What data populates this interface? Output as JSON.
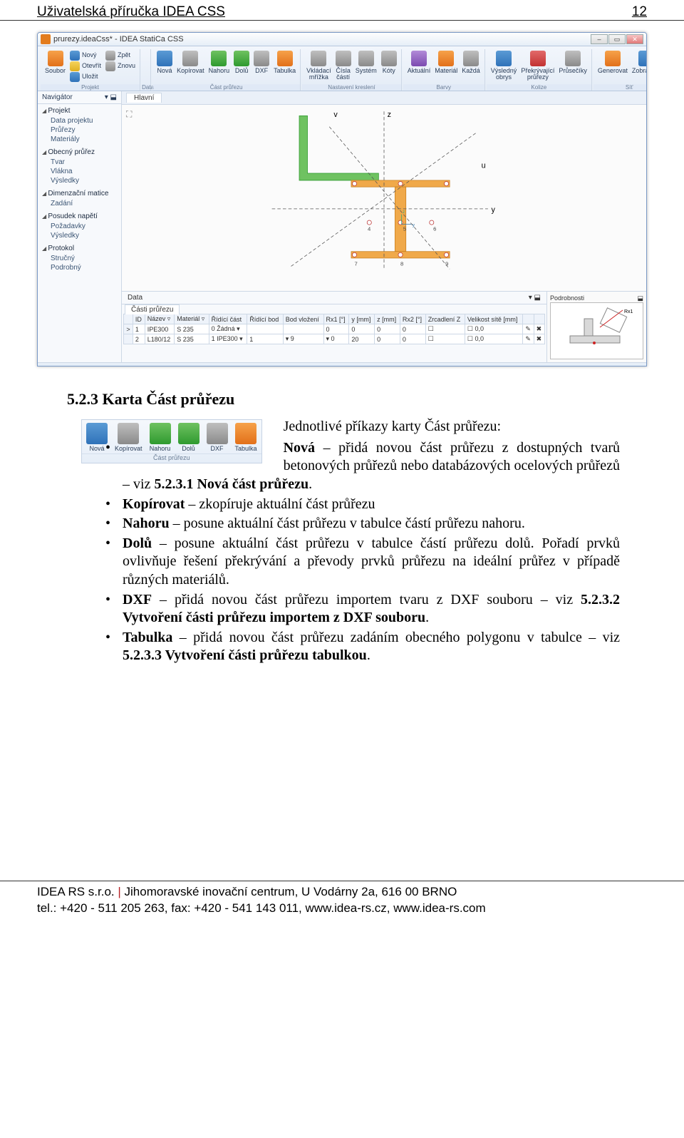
{
  "header": {
    "title": "Uživatelská příručka IDEA CSS",
    "page_num": "12"
  },
  "app": {
    "title": "prurezy.ideaCss* - IDEA StatiCa CSS",
    "window_buttons": {
      "min": "–",
      "max": "▭",
      "close": "✕"
    },
    "ribbon_groups": [
      {
        "label": "Projekt",
        "items": [
          {
            "icon": "icn-orange",
            "text": "Soubor"
          }
        ],
        "stack": [
          {
            "icon": "icn-blue",
            "text": "Nový"
          },
          {
            "icon": "icn-yellow",
            "text": "Otevřít"
          },
          {
            "icon": "icn-blue",
            "text": "Uložit"
          }
        ],
        "stack2": [
          {
            "icon": "icn-gray",
            "text": "Zpět"
          },
          {
            "icon": "icn-gray",
            "text": "Znovu"
          }
        ]
      },
      {
        "label": "Data",
        "items": []
      },
      {
        "label": "Část průřezu",
        "items": [
          {
            "icon": "icn-blue",
            "text": "Nová"
          },
          {
            "icon": "icn-gray",
            "text": "Kopírovat"
          },
          {
            "icon": "icn-green",
            "text": "Nahoru"
          },
          {
            "icon": "icn-green",
            "text": "Dolů"
          },
          {
            "icon": "icn-gray",
            "text": "DXF"
          },
          {
            "icon": "icn-orange",
            "text": "Tabulka"
          }
        ]
      },
      {
        "label": "Nastavení kreslení",
        "items": [
          {
            "icon": "icn-gray",
            "text": "Vkládací mřížka"
          },
          {
            "icon": "icn-gray",
            "text": "Čísla částí"
          },
          {
            "icon": "icn-gray",
            "text": "Systém"
          },
          {
            "icon": "icn-gray",
            "text": "Kóty"
          }
        ]
      },
      {
        "label": "Barvy",
        "items": [
          {
            "icon": "icn-purple",
            "text": "Aktuální"
          },
          {
            "icon": "icn-orange",
            "text": "Materiál"
          },
          {
            "icon": "icn-gray",
            "text": "Každá"
          }
        ]
      },
      {
        "label": "Kolize",
        "items": [
          {
            "icon": "icn-blue",
            "text": "Výsledný obrys"
          },
          {
            "icon": "icn-red",
            "text": "Překrývající průřezy"
          },
          {
            "icon": "icn-gray",
            "text": "Průsečíky"
          }
        ]
      },
      {
        "label": "Síť",
        "items": [
          {
            "icon": "icn-orange",
            "text": "Generovat"
          },
          {
            "icon": "icn-blue",
            "text": "Zobrazení"
          }
        ]
      }
    ],
    "nav": {
      "title": "Navigátor",
      "pin": "▾ ⬓",
      "groups": [
        {
          "head": "Projekt",
          "items": [
            "Data projektu",
            "Průřezy",
            "Materiály"
          ]
        },
        {
          "head": "Obecný průřez",
          "items": [
            "Tvar",
            "Vlákna",
            "Výsledky"
          ]
        },
        {
          "head": "Dimenzační matice",
          "items": [
            "Zadání"
          ]
        },
        {
          "head": "Posudek napětí",
          "items": [
            "Požadavky",
            "Výsledky"
          ]
        },
        {
          "head": "Protokol",
          "items": [
            "Stručný",
            "Podrobný"
          ]
        }
      ]
    },
    "canvas_tab": "Hlavní",
    "canvas_icon": "⛶",
    "axis_labels": {
      "v": "v",
      "z": "z",
      "u": "u",
      "y": "y"
    },
    "node_labels": [
      "4",
      "5",
      "6",
      "7",
      "8",
      "9"
    ],
    "data_pane": {
      "title": "Data",
      "tab": "Části průřezu",
      "pin": "▾ ⬓",
      "columns": [
        "",
        "ID",
        "Název ▿",
        "Materiál ▿",
        "Řídící část",
        "Řídící bod",
        "Bod vložení",
        "Rx1 [°]",
        "y [mm]",
        "z [mm]",
        "Rx2 [°]",
        "Zrcadlení Z",
        "Velikost sítě [mm]",
        "",
        ""
      ],
      "rows": [
        [
          ">",
          "1",
          "IPE300",
          "S 235",
          "0 Žádná ▾",
          "",
          "",
          "0",
          "0",
          "0",
          "0",
          "☐",
          "☐ 0,0",
          "✎",
          "✖"
        ],
        [
          "",
          "2",
          "L180/12",
          "S 235",
          "1 IPE300 ▾",
          "1",
          "▾ 9",
          "▾ 0",
          "20",
          "0",
          "0",
          "☐",
          "☐ 0,0",
          "✎",
          "✖"
        ]
      ]
    },
    "detail_pane": {
      "title": "Podrobnosti",
      "pin": "⬓"
    },
    "statusbar": ""
  },
  "section": {
    "number": "5.2.3",
    "title": "Karta Část průřezu"
  },
  "karta_ribbon": {
    "items": [
      {
        "icon": "icn-blue",
        "text": "Nová"
      },
      {
        "icon": "icn-gray",
        "text": "Kopírovat"
      },
      {
        "icon": "icn-green",
        "text": "Nahoru"
      },
      {
        "icon": "icn-green",
        "text": "Dolů"
      },
      {
        "icon": "icn-gray",
        "text": "DXF"
      },
      {
        "icon": "icn-orange",
        "text": "Tabulka"
      }
    ],
    "label": "Část průřezu"
  },
  "para_intro": "Jednotlivé příkazy karty Část průřezu:",
  "bullets": [
    {
      "bold": "Nová",
      "text": " – přidá novou část průřezu z dostupných tvarů betonových průřezů nebo databázových ocelových průřezů – viz ",
      "ref": "5.2.3.1 Nová část průřezu",
      "suffix": "."
    },
    {
      "bold": "Kopírovat",
      "text": " – zkopíruje aktuální část průřezu"
    },
    {
      "bold": "Nahoru",
      "text": " – posune aktuální část průřezu v tabulce částí průřezu nahoru."
    },
    {
      "bold": "Dolů",
      "text": " – posune aktuální část průřezu v tabulce částí průřezu dolů. Pořadí prvků ovlivňuje řešení překrývání a převody prvků průřezu na ideální průřez v případě různých materiálů."
    },
    {
      "bold": "DXF",
      "text": " – přidá novou část průřezu importem tvaru z DXF souboru – viz ",
      "ref": "5.2.3.2 Vytvoření části průřezu importem z DXF souboru",
      "suffix": "."
    },
    {
      "bold": "Tabulka",
      "text": " – přidá novou část průřezu zadáním obecného polygonu v tabulce – viz ",
      "ref": "5.2.3.3 Vytvoření části průřezu tabulkou",
      "suffix": "."
    }
  ],
  "footer": {
    "line1_a": "IDEA RS s.r.o.",
    "line1_sep": " | ",
    "line1_b": "Jihomoravské inovační centrum, U Vodárny 2a, 616 00 BRNO",
    "line2": "tel.: +420 - 511 205 263, fax: +420 - 541 143 011, www.idea-rs.cz, www.idea-rs.com"
  }
}
